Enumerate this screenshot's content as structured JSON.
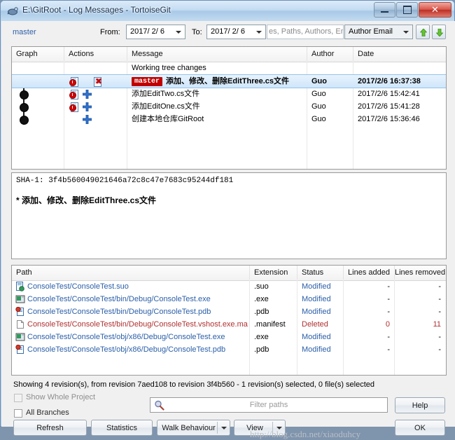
{
  "window": {
    "title": "E:\\GitRoot - Log Messages - TortoiseGit",
    "icon": "tortoisegit-icon",
    "minimize_label": "Minimize",
    "maximize_label": "Maximize",
    "close_label": "Close"
  },
  "toolbar": {
    "branch": "master",
    "from_label": "From:",
    "from_value": "2017/ 2/ 6",
    "to_label": "To:",
    "to_value": "2017/ 2/ 6",
    "search_placeholder": "es, Paths, Authors, Email",
    "filter_mode": "Author Email",
    "up_button": "up-arrow",
    "down_button": "down-arrow"
  },
  "log": {
    "columns": [
      "Graph",
      "Actions",
      "Message",
      "Author",
      "Date"
    ],
    "working_tree_row": "Working tree changes",
    "rows": [
      {
        "ref": "master",
        "message": "添加、修改、删除EditThree.cs文件",
        "author": "Guo",
        "date": "2017/2/6  16:37:38",
        "actions": [
          "modified",
          "deleted"
        ],
        "selected": true
      },
      {
        "ref": "",
        "message": "添加EditTwo.cs文件",
        "author": "Guo",
        "date": "2017/2/6 15:42:41",
        "actions": [
          "modified",
          "added"
        ],
        "selected": false
      },
      {
        "ref": "",
        "message": "添加EditOne.cs文件",
        "author": "Guo",
        "date": "2017/2/6 15:41:28",
        "actions": [
          "modified",
          "added"
        ],
        "selected": false
      },
      {
        "ref": "",
        "message": "创建本地仓库GitRoot",
        "author": "Guo",
        "date": "2017/2/6 15:36:46",
        "actions": [
          "added"
        ],
        "selected": false
      }
    ]
  },
  "message_panel": {
    "sha_label": "SHA-1:",
    "sha_value": "3f4b560049021646a72c8c47e7683c95244df181",
    "sha_line": "SHA-1:  3f4b560049021646a72c8c47e7683c95244df181",
    "body": "* 添加、修改、删除EditThree.cs文件"
  },
  "files": {
    "columns": [
      "Path",
      "Extension",
      "Status",
      "Lines added",
      "Lines removed"
    ],
    "rows": [
      {
        "path": "ConsoleTest/ConsoleTest.suo",
        "extension": ".suo",
        "status": "Modified",
        "lines_added": "-",
        "lines_removed": "-",
        "icon": "suo-file-icon",
        "color": "#2b5fa8"
      },
      {
        "path": "ConsoleTest/ConsoleTest/bin/Debug/ConsoleTest.exe",
        "extension": ".exe",
        "status": "Modified",
        "lines_added": "-",
        "lines_removed": "-",
        "icon": "exe-file-icon",
        "color": "#2b5fa8"
      },
      {
        "path": "ConsoleTest/ConsoleTest/bin/Debug/ConsoleTest.pdb",
        "extension": ".pdb",
        "status": "Modified",
        "lines_added": "-",
        "lines_removed": "-",
        "icon": "pdb-file-icon",
        "color": "#2b5fa8"
      },
      {
        "path": "ConsoleTest/ConsoleTest/bin/Debug/ConsoleTest.vshost.exe.manifest",
        "extension": ".manifest",
        "status": "Deleted",
        "lines_added": "0",
        "lines_removed": "11",
        "icon": "blank-file-icon",
        "color": "#b03030"
      },
      {
        "path": "ConsoleTest/ConsoleTest/obj/x86/Debug/ConsoleTest.exe",
        "extension": ".exe",
        "status": "Modified",
        "lines_added": "-",
        "lines_removed": "-",
        "icon": "exe-file-icon",
        "color": "#2b5fa8"
      },
      {
        "path": "ConsoleTest/ConsoleTest/obj/x86/Debug/ConsoleTest.pdb",
        "extension": ".pdb",
        "status": "Modified",
        "lines_added": "-",
        "lines_removed": "-",
        "icon": "pdb-file-icon",
        "color": "#2b5fa8"
      }
    ]
  },
  "footer": {
    "status": "Showing 4 revision(s), from revision 7aed108 to revision 3f4b560 - 1 revision(s) selected, 0 file(s) selected",
    "show_whole_project": "Show Whole Project",
    "all_branches": "All Branches",
    "filter_placeholder": "Filter paths",
    "help_label": "Help",
    "refresh_label": "Refresh",
    "statistics_label": "Statistics",
    "walk_behaviour_label": "Walk Behaviour",
    "view_label": "View",
    "ok_label": "OK",
    "watermark": "http://blog.csdn.net/xiaoduhcy"
  },
  "colors": {
    "accent_blue": "#2b5fa8",
    "ref_badge": "#c00000",
    "deleted": "#b03030",
    "status_link": "#2b5fa8"
  }
}
